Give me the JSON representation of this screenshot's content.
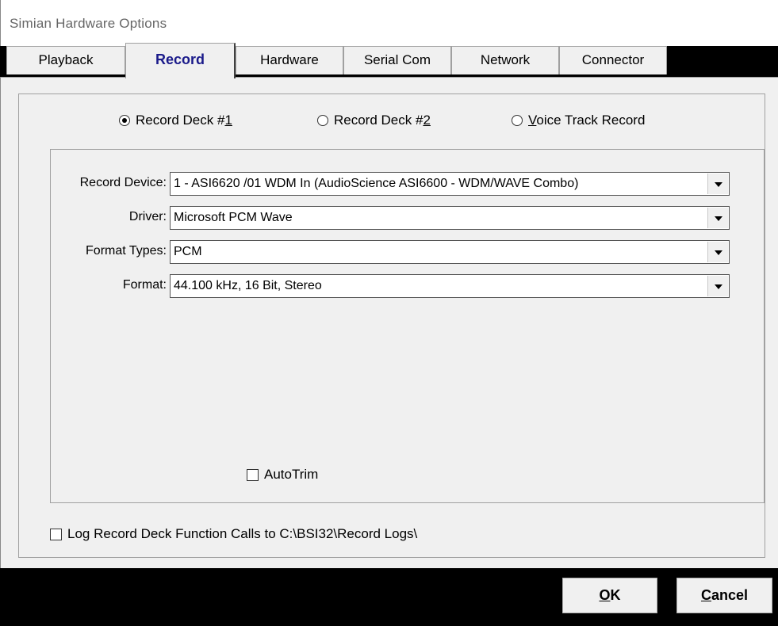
{
  "window": {
    "title": "Simian Hardware Options"
  },
  "tabs": [
    {
      "label": "Playback"
    },
    {
      "label": "Record"
    },
    {
      "label": "Hardware"
    },
    {
      "label": "Serial Com"
    },
    {
      "label": "Network"
    },
    {
      "label": "Connector"
    }
  ],
  "record_deck": {
    "options": [
      {
        "label_pre": "Record Deck #",
        "accel": "1",
        "label_post": "",
        "selected": true
      },
      {
        "label_pre": "Record Deck #",
        "accel": "2",
        "label_post": "",
        "selected": false
      },
      {
        "label_pre": "",
        "accel": "V",
        "label_post": "oice Track Record",
        "selected": false
      }
    ]
  },
  "fields": {
    "record_device": {
      "label": "Record Device:",
      "value": "1 - ASI6620 /01 WDM In (AudioScience ASI6600 - WDM/WAVE Combo)"
    },
    "driver": {
      "label": "Driver:",
      "value": "Microsoft PCM Wave"
    },
    "format_types": {
      "label": "Format Types:",
      "value": "PCM"
    },
    "format": {
      "label": "Format:",
      "value": "44.100 kHz, 16 Bit, Stereo"
    }
  },
  "autotrim": {
    "label": "AutoTrim",
    "checked": false
  },
  "log_calls": {
    "label": "Log Record Deck Function Calls to C:\\BSI32\\Record Logs\\",
    "checked": false
  },
  "buttons": {
    "ok": {
      "accel": "O",
      "rest": "K"
    },
    "cancel": {
      "accel": "C",
      "rest": "ancel"
    }
  }
}
